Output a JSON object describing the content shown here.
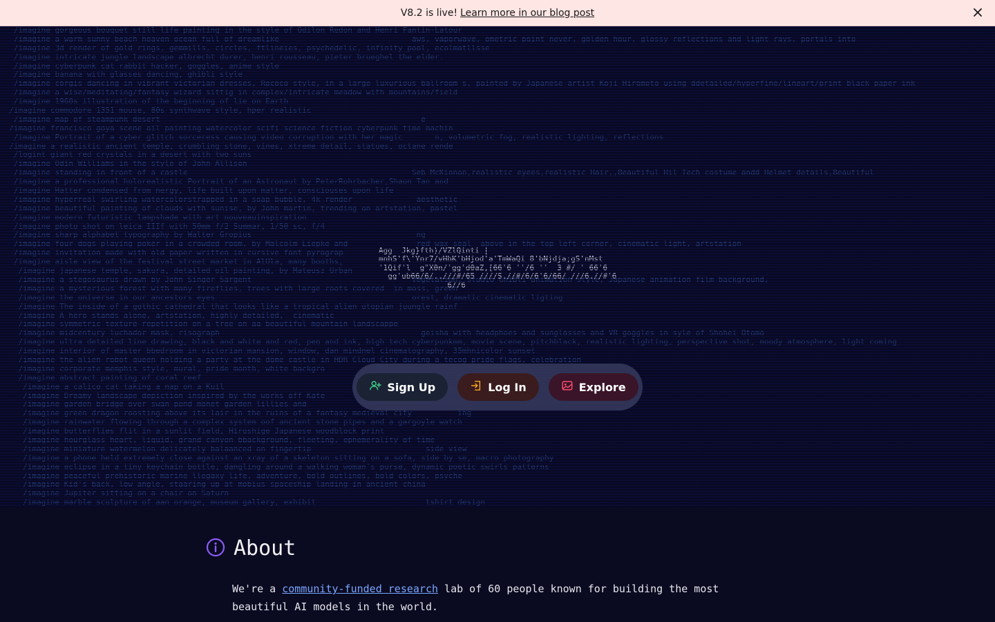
{
  "banner": {
    "text": "V8.2 is live!",
    "link": "Learn more in our blog post",
    "close_icon": "close-icon"
  },
  "hero": {
    "prompt_lines": [
      "   /imagine gorgeous bouquet still life painting in the style of Odilon Redon and Henri Fantin-Latour",
      "   /imagine a warm sunny beach heaven ocean full of dreamlike                             aws, vaporwave, ometric point never, golden hour, glossy reflections and light rays, portals into",
      "   /imagine 3d render of gold rings, gemmills, circles, ftlineies, psychedelic, infinity pool, ecolmatllsse",
      "   /imagine intricate jungle landscape albrecht durer, henri rousseau, pieter brueghel the elder.",
      "   /imagine cyberpunk cat rabbit hacker, goggles, anime style",
      "   /imagine banana with glasses dancing, ghibli style",
      "   /imagine corgis dancing in vibrant victorian dresses, Rococo style, in a large luxurious ballroom s, painted by Japanese artist Koji Hiromoto using ddetailed/hyperfine/lineart/print black paper ink",
      "   /imagine a wise/meditating/fantasy wizard sittig in complex/intricate meadow with mountains/field",
      "   /imagine 1960s illustration of the beginning of lie on Earth",
      "  /imagine commodore 1351 mouse, 80s synthwave style, hper realistic",
      "   /imagine map of steampunk desert                                                         e",
      "  /imagine francisco goya scene oil painting watercolor scifi science fiction cyberpunk time machin",
      "   /imagine Portrait of a cyber glitch sorceress causing video corruption with her magic       n, volumetric fog, realistic lighting, reflections",
      "  /imagine a realistic ancient temple, crumbling stone, vines, xtreme detail, statues, octane rende",
      "   /logint giant red crystals in a desert with two suns",
      "   /imagine Odin Williams in the style of John Allison",
      "   /imagine standing in front of a castle                                                 Seb McKinnon,realistic eyees,realistic Hair,,Beautiful Hil Tech costume andd Helmet details,Beautiful",
      "   /imagine a professional holorealistic Portrait of an Astronaut by PeterRohrbacher,Shaun Tan and",
      "   /imagine Hatter condensed from nergy, life built upon matter, consciouses upon life",
      "   /imagine hyperreal swirling watercolorstrapped in a soap bubble, 4k render              aesthetic",
      "   /imagine beautiful painting of clouds with sunise, by John martin, trending on artstation, pastel",
      "   /imagine modern futuristic lampshade with art nouveauinspiration",
      "   /imagine photo shot on leica IIIf with 50mm f/2 Summar, 1/50 sc, f/4",
      "   /imagine sharp alphabet typography by Walter Gropius                                    ng",
      "   /imagine four dogs playing poker in a crowded room, by Malcolm Liepke and               red wax seal  above in the top left corner, cinematic light, artstation",
      "   /imagine invitation made with old paper written in cursive font pyrograp",
      "   /imagine aisle view of the festival street market in AlUla, many booths,",
      "    /imagine japanese temple, sakura, detailed oil painting, by Mateusz Urban",
      "    /imagine a stegosaurus drawn by John Singer Sargent                                   vegetation, Studio Ghibli animation style, Japanese animation film background,",
      "    /imagine a mysterious forest with many fireflies, trees with large roots covered  in moss, green",
      "    /imagine the universe in our ancestors eyes                                           orest, dramatic cinematic ligting",
      "    /imagine The inside of a gothic cathedral that looks like a tropical alien utopian juungle rainf",
      "    /imagine A hero stands alone, artstation, highly detailed,  cinematic",
      "    /imagine symmetric texture repetition on a tree on aa beautiful mountain landscappe",
      "    /imagine midcentury luchador mask, risograph                                            geisha with headphoes and sunglasses and VR goggles in syle of Shohei Otomo",
      "    /imagine ultra detailed line drawing, black and white and red, pen and ink, high tech cyberpunkmm, movie scene, pitchblack, realistic lighting, perspective shot, moody atmosphere, light coming",
      "    /imagine interior of master bbedroom in victorian mansion, window, dan mindnel cinematography, 35mhnicolor sunset",
      "    /imagine the alien robot queen holding a party at the dome castle in HDR Cloud City during a tecog pride flags, celebration",
      "    /imagine corporate memphis style, mural, pride month, white backgro",
      "    /imagine abstract painting of coral reef",
      "     /imagine a calico cat taking a nap on a Kuil",
      "     /imagine Dreamy landscape depiction inspired by the works off Kate",
      "     /imagine garden bridge over swan pond monet garden lillies and",
      "     /imagine green dragon roosting above its lair in the ruins of a fantasy medieval city          ing",
      "     /imagine rainwater flowing through a complex system oof ancient stone pipes and a gargoyle watch",
      "     /imagine butterflies flit in a sunlit field, Hiroshige Japanese woodblock print",
      "     /imagine hourglass heart, liquid, grand canyon bbackground, fleeting, ephemerality of time",
      "     /imagine miniature watermelon delicately balaanced on fingertip                         side view",
      "     /imagine a phone held extremely close against an xray of a skeleton sitting on a sofa, side by se, macro photography",
      "     /imagine eclipse in a tiny keychain bottle, dangling around a walking woman's purse, dynamic poetic swirls patterns",
      "     /imagine peaceful prehistoric marine llegaxy life, adventure, bold outlines, bold colors, psyche",
      "     /imagine Kid's back, low angle, staaring up at mobius spaceship landing in ancient china",
      "     /imagine Jupiter sitting on a chair on Saturn",
      "     /imagine marble sculpture of aan orange, museum gallery, exhibit                        tshirt design"
    ],
    "glitch_lines": [
      "                                    ",
      "Agg  Jkg}fth)/VZlQinti |",
      "mnhS'f\\'Ynr7/vHhK'bHjod'a'TmWaQi 8'bNjdja;gS'nMst",
      "'1Qif'l  g\"X0n/'gg'd0aZ,[66'6 ''/6 ''  3 #/ ' 66'6",
      "  gg'ub66/6/..///#/65 ////S.//#/6/6'6/66/ ///6.//#'6",
      "               6//6                          "
    ]
  },
  "cta": {
    "signup": "Sign Up",
    "login": "Log In",
    "explore": "Explore"
  },
  "about": {
    "title": "About",
    "text_before": "We're a ",
    "link": "community-funded research",
    "text_after": " lab of 60 people known for building the most beautiful AI models in the world."
  },
  "colors": {
    "banner_bg": "#fde6e4",
    "page_bg": "#0a0a20",
    "signup_icon": "#3fd18a",
    "login_icon": "#f5a623",
    "explore_icon": "#ff4d6d",
    "about_icon": "#8b5cf6",
    "link": "#7aa8ff"
  }
}
